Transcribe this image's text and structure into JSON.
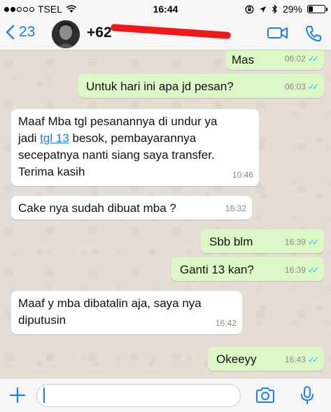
{
  "status_bar": {
    "carrier": "TSEL",
    "time": "16:44",
    "battery": "29%",
    "battery_level": 0.29
  },
  "header": {
    "back_count": "23",
    "contact_number": "+62",
    "icons": [
      "back-chevron-icon",
      "video-call-icon",
      "phone-call-icon"
    ]
  },
  "messages": [
    {
      "dir": "out",
      "text": "Mas",
      "time": "06:02",
      "read": true
    },
    {
      "dir": "out",
      "text": "Untuk hari ini apa jd pesan?",
      "time": "06:03",
      "read": true
    },
    {
      "dir": "in",
      "line1": "Maaf Mba tgl pesanannya di undur ya",
      "line2_pre": "jadi ",
      "line2_link": "tgl 13",
      "line2_post": " besok, pembayarannya",
      "line3": "secepatnya nanti siang saya transfer.",
      "line4": "Terima kasih",
      "time": "10:46"
    },
    {
      "dir": "in",
      "text": "Cake nya sudah dibuat mba ?",
      "time": "16:32"
    },
    {
      "dir": "out",
      "text": "Sbb blm",
      "time": "16:39",
      "read": true
    },
    {
      "dir": "out",
      "text": "Ganti 13 kan?",
      "time": "16:39",
      "read": true
    },
    {
      "dir": "in",
      "line1": "Maaf y mba dibatalin aja, saya nya",
      "line2": "diputusin",
      "time": "16:42"
    },
    {
      "dir": "out",
      "text": "Okeeyy",
      "time": "16:43",
      "read": true
    }
  ],
  "input": {
    "placeholder": ""
  },
  "colors": {
    "accent": "#1a7ff5",
    "outgoing_bubble": "#dcf8c6",
    "incoming_bubble": "#ffffff",
    "read_ticks": "#34b7f1",
    "redaction": "#f01818"
  }
}
